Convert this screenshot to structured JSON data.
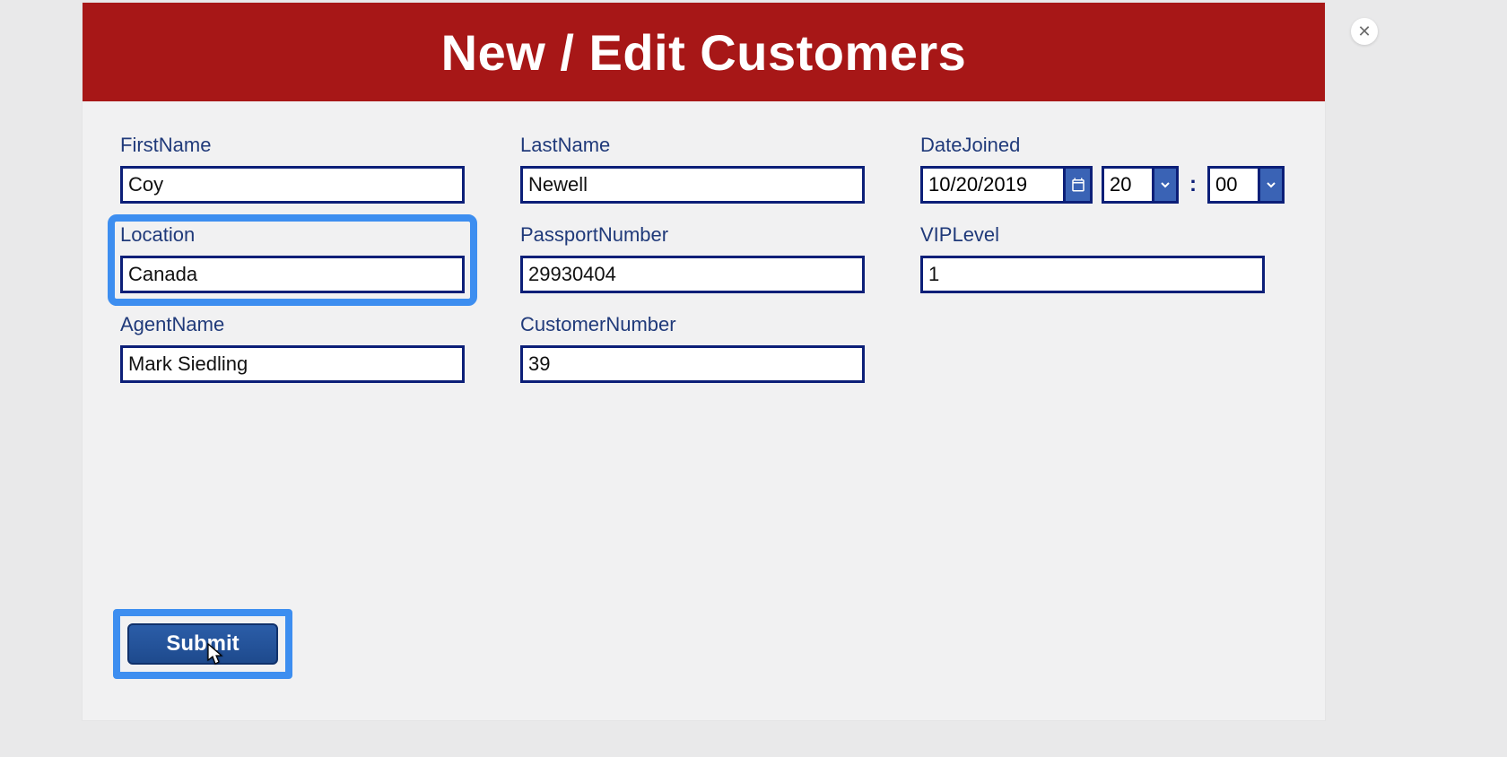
{
  "header": {
    "title": "New / Edit Customers"
  },
  "fields": {
    "firstName": {
      "label": "FirstName",
      "value": "Coy"
    },
    "lastName": {
      "label": "LastName",
      "value": "Newell"
    },
    "dateJoined": {
      "label": "DateJoined",
      "date": "10/20/2019",
      "hour": "20",
      "minute": "00",
      "sep": ":"
    },
    "location": {
      "label": "Location",
      "value": "Canada"
    },
    "passport": {
      "label": "PassportNumber",
      "value": "29930404"
    },
    "vip": {
      "label": "VIPLevel",
      "value": "1"
    },
    "agent": {
      "label": "AgentName",
      "value": "Mark Siedling"
    },
    "custNo": {
      "label": "CustomerNumber",
      "value": "39"
    }
  },
  "buttons": {
    "submit": "Submit",
    "close": "✕"
  }
}
